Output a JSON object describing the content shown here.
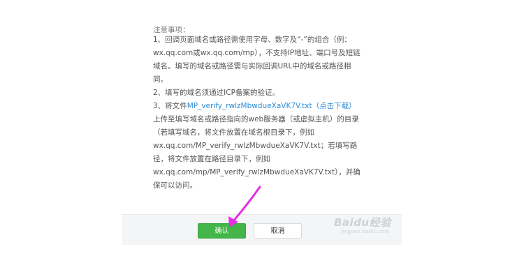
{
  "notes": {
    "heading": "注意事项：",
    "item1": "1、回调页面域名或路径需使用字母、数字及“-”的组合（例：wx.qq.com或wx.qq.com/mp），不支持IP地址、端口号及短链域名。填写的域名或路径需与实际回调URL中的域名或路径相同。",
    "item2": "2、填写的域名须通过ICP备案的验证。",
    "item3_prefix": "3、将文件",
    "item3_filename": "MP_verify_rwlzMbwdueXaVK7V.txt",
    "item3_download": "（点击下载）",
    "item3_rest": "上传至填写域名或路径指向的web服务器（或虚拟主机）的目录（若填写域名，将文件放置在域名根目录下，例如wx.qq.com/MP_verify_rwlzMbwdueXaVK7V.txt；若填写路径，将文件放置在路径目录下，例如wx.qq.com/mp/MP_verify_rwlzMbwdueXaVK7V.txt），并确保可以访问。"
  },
  "footer": {
    "confirm_label": "确认",
    "cancel_label": "取消"
  },
  "watermark": {
    "text": "Baidu经验",
    "sub": "jingyan.baidu.com"
  },
  "colors": {
    "accent_green": "#44b549",
    "link_blue": "#2d8cd6",
    "arrow_magenta": "#e62ee6"
  }
}
